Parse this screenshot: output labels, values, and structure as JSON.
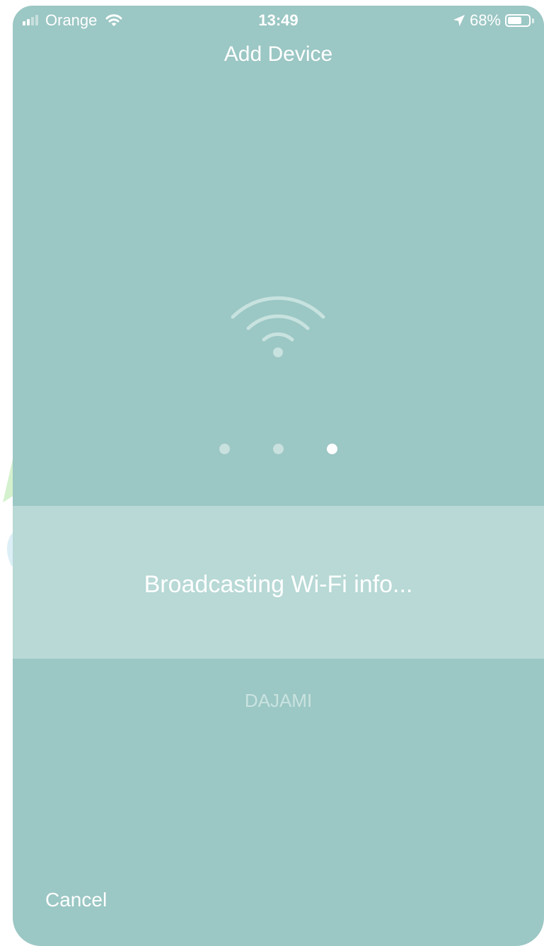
{
  "status_bar": {
    "carrier": "Orange",
    "time": "13:49",
    "battery_percent": "68%",
    "battery_level": 0.68,
    "signal_bars_active": 2,
    "signal_bars_total": 4
  },
  "nav": {
    "title": "Add Device"
  },
  "progress": {
    "step_count": 3,
    "active_step": 3
  },
  "status": {
    "message": "Broadcasting Wi-Fi info..."
  },
  "network": {
    "name": "DAJAMI"
  },
  "actions": {
    "cancel_label": "Cancel"
  },
  "colors": {
    "background": "#9bc7c4",
    "band": "#b8d9d6",
    "dot_active": "#ffffff",
    "dot_inactive": "#c8e0de"
  },
  "icons": {
    "wifi": "wifi-icon",
    "location": "location-arrow-icon",
    "battery": "battery-icon",
    "signal": "cellular-signal-icon"
  }
}
